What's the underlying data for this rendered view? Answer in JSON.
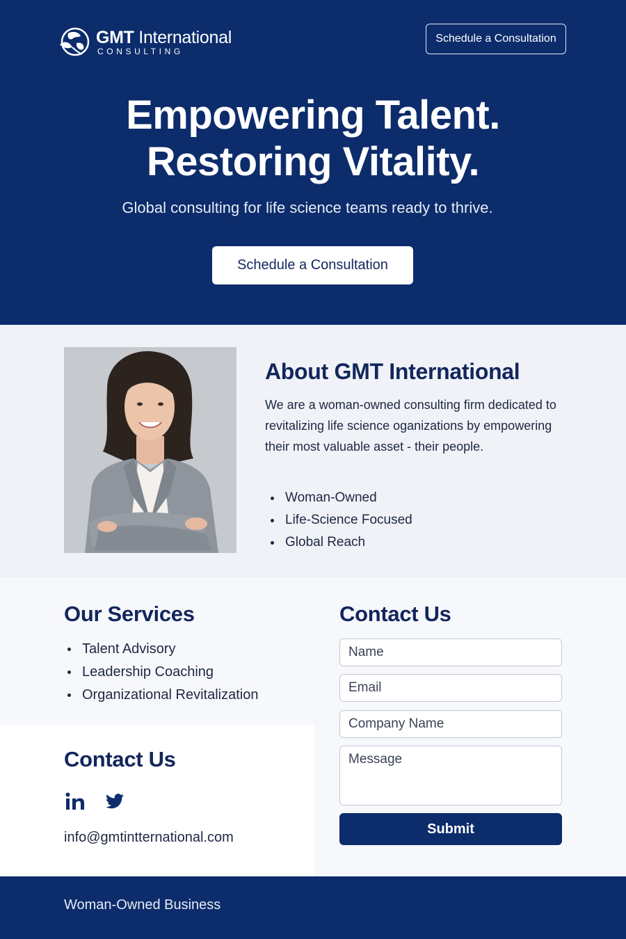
{
  "header": {
    "logo_name_bold": "GMT",
    "logo_name_rest": " International",
    "logo_sub": "CONSULTING",
    "cta_label": "Schedule a Consultation"
  },
  "hero": {
    "title_line1": "Empowering Talent.",
    "title_line2": "Restoring Vitality.",
    "subtitle": "Global consulting for life science teams ready to thrive.",
    "cta_label": "Schedule a Consultation"
  },
  "about": {
    "title": "About GMT International",
    "body": "We are a woman-owned consulting firm dedicated to revitalizing life science oganizations by empowering their most valuable asset - their people.",
    "highlights": [
      "Woman-Owned",
      "Life-Science Focused",
      "Global Reach"
    ]
  },
  "services": {
    "title": "Our Services",
    "items": [
      "Talent Advisory",
      "Leadership Coaching",
      "Organizational Revitalization"
    ]
  },
  "contact_info": {
    "title": "Contact Us",
    "email": "info@gmtintternational.com",
    "social_icons": [
      "linkedin-icon",
      "twitter-icon"
    ]
  },
  "contact_form": {
    "title": "Contact Us",
    "name_placeholder": "Name",
    "email_placeholder": "Email",
    "company_placeholder": "Company Name",
    "message_placeholder": "Message",
    "submit_label": "Submit"
  },
  "footer": {
    "text": "Woman-Owned Business"
  },
  "colors": {
    "brand_navy": "#0c2c6b",
    "heading_navy": "#13265c",
    "about_bg": "#f0f2f7"
  }
}
